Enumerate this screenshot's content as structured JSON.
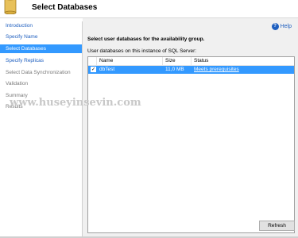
{
  "header": {
    "title": "Select Databases"
  },
  "sidebar": {
    "items": [
      {
        "label": "Introduction",
        "state": "link"
      },
      {
        "label": "Specify Name",
        "state": "link"
      },
      {
        "label": "Select Databases",
        "state": "selected"
      },
      {
        "label": "Specify Replicas",
        "state": "link"
      },
      {
        "label": "Select Data Synchronization",
        "state": "inactive"
      },
      {
        "label": "Validation",
        "state": "inactive"
      },
      {
        "label": "Summary",
        "state": "inactive"
      },
      {
        "label": "Results",
        "state": "inactive"
      }
    ]
  },
  "main": {
    "help_label": "Help",
    "instruction": "Select user databases for the availability group.",
    "table_label": "User databases on this instance of SQL Server:",
    "columns": [
      "Name",
      "Size",
      "Status"
    ],
    "rows": [
      {
        "name": "dbTest",
        "size": "11,0 MB",
        "status": "Meets prerequisites",
        "checked": true
      }
    ],
    "refresh_label": "Refresh"
  },
  "watermark": "www.huseyinsevin.com",
  "colors": {
    "selection": "#3399ff",
    "link": "#1f5fbf"
  }
}
